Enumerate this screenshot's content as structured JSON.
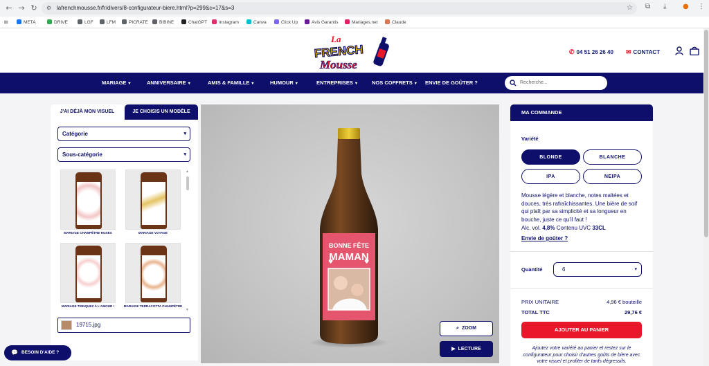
{
  "browser": {
    "url": "lafrenchmousse.fr/fr/divers/8-configurateur-biere.html?p=299&c=17&s=3",
    "bookmarks": [
      {
        "label": "META",
        "color": "#1877f2"
      },
      {
        "label": "DRIVE",
        "color": "#34a853"
      },
      {
        "label": "LGF",
        "color": "#5f6368"
      },
      {
        "label": "LFM",
        "color": "#5f6368"
      },
      {
        "label": "PICRATE",
        "color": "#5f6368"
      },
      {
        "label": "BIBINE",
        "color": "#5f6368"
      },
      {
        "label": "ChatGPT",
        "color": "#202124"
      },
      {
        "label": "Instagram",
        "color": "#e1306c"
      },
      {
        "label": "Canva",
        "color": "#00c4cc"
      },
      {
        "label": "Click Up",
        "color": "#7b68ee"
      },
      {
        "label": "Avis Garantis",
        "color": "#6a1b9a"
      },
      {
        "label": "Mariages.net",
        "color": "#e91e63"
      },
      {
        "label": "Claude",
        "color": "#d97757"
      }
    ]
  },
  "header": {
    "logo_line1": "La",
    "logo_line2": "FRENCH",
    "logo_line3": "Mousse",
    "phone": "04 51 26 26 40",
    "contact": "CONTACT"
  },
  "nav": {
    "items": [
      "MARIAGE",
      "ANNIVERSAIRE",
      "AMIS & FAMILLE",
      "HUMOUR",
      "ENTREPRISES",
      "NOS COFFRETS",
      "ENVIE DE GOÛTER ?"
    ],
    "search_placeholder": "Recherche..."
  },
  "left": {
    "tab_own": "J'AI DÉJÀ MON VISUEL",
    "tab_model": "JE CHOISIS UN MODÈLE",
    "category": "Catégorie",
    "subcategory": "Sous-catégorie",
    "models": [
      "MARIAGE CHAMPÊTRE ROSES",
      "MARIAGE VOYAGE",
      "MARIAGE TRINQUEZ À L'AMOUR !",
      "MARIAGE TERRACOTTA CHAMPÊTRE"
    ],
    "file_name": "19715.jpg",
    "help": "BESOIN D'AIDE ?"
  },
  "viewer": {
    "label_line1": "BONNE FÊTE",
    "label_line2": "MAMAN",
    "zoom": "ZOOM",
    "play": "LECTURE"
  },
  "order": {
    "title": "MA COMMANDE",
    "variety_label": "Variété",
    "varieties": [
      "BLONDE",
      "BLANCHE",
      "IPA",
      "NEIPA"
    ],
    "description": "Mousse légère et blanche, notes maltées et douces, très rafraîchissantes. Une bière de soif qui plaît par sa simplicité et sa longueur en bouche, juste ce qu'il faut !",
    "alc_prefix": "Alc. vol.",
    "alc_value": "4,8%",
    "volume_prefix": "Contenu UVC",
    "volume_value": "33CL",
    "taste_link": "Envie de goûter ?",
    "qty_label": "Quantité",
    "qty_value": "6",
    "unit_price_label": "PRIX UNITAIRE",
    "unit_price_value": "4,96 € bouteille",
    "total_label": "TOTAL TTC",
    "total_value": "29,76 €",
    "add_to_cart": "AJOUTER AU PANIER",
    "note": "Ajoutez votre variété au panier et restez sur le configurateur pour choisir d'autres goûts de bière avec votre visuel et profiter de tarifs dégressifs."
  },
  "colors": {
    "brand_navy": "#0d0f6b",
    "accent_red": "#e8182a"
  }
}
